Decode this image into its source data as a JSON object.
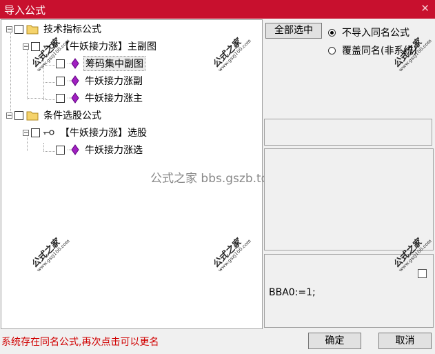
{
  "window": {
    "title": "导入公式",
    "close_glyph": "✕"
  },
  "tree": {
    "groups": [
      {
        "label": "技术指标公式",
        "children": [
          {
            "label": "【牛妖接力涨】主副图",
            "children": [
              {
                "label": "筹码集中副图",
                "selected": true
              },
              {
                "label": "牛妖接力涨副"
              },
              {
                "label": "牛妖接力涨主"
              }
            ]
          }
        ]
      },
      {
        "label": "条件选股公式",
        "children": [
          {
            "label": "【牛妖接力涨】选股",
            "children": [
              {
                "label": "牛妖接力涨选"
              }
            ]
          }
        ]
      }
    ]
  },
  "watermark": {
    "big": "公式之家",
    "small": "www.gszj100.com",
    "center": "公式之家 bbs.gszb.top"
  },
  "right": {
    "select_all_label": "全部选中",
    "radio_options": [
      {
        "label": "不导入同名公式",
        "checked": true
      },
      {
        "label": "覆盖同名(非系统)",
        "checked": false
      }
    ],
    "formula_text": "BBA0:=1;"
  },
  "status_text": "系统存在同名公式,再次点击可以更名",
  "buttons": {
    "ok": "确定",
    "cancel": "取消"
  },
  "colors": {
    "titlebar": "#c8102e",
    "status": "#d00000",
    "leaf_icon": "#a020c0"
  },
  "icons": {
    "group": "folder-icon",
    "formula": "key-icon",
    "leaf": "diamond-icon"
  }
}
